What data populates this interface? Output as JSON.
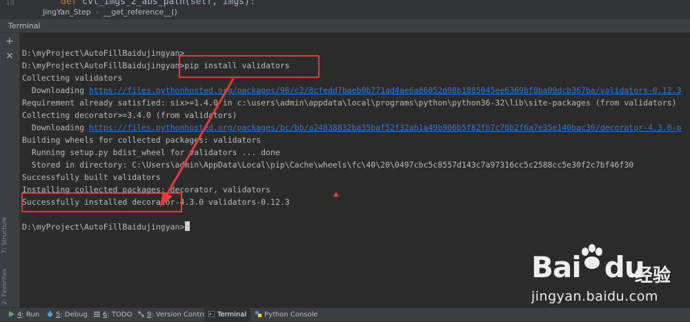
{
  "editor": {
    "line_number": "18",
    "code_keyword": "def",
    "code_rest": " cvt_imgs_2_abs_path(self, imgs):",
    "breadcrumbs": [
      "JingYan_Step",
      "__get_reference__()"
    ]
  },
  "panel": {
    "title": "Terminal",
    "add_label": "+",
    "close_label": "×"
  },
  "side_labels": {
    "structure": "7: Structure",
    "favorites": "2: Favorites"
  },
  "terminal": {
    "lines": [
      {
        "text": "D:\\myProject\\AutoFillBaidujingyan>"
      },
      {
        "text": "D:\\myProject\\AutoFillBaidujingyan>pip install validators"
      },
      {
        "text": "Collecting validators"
      },
      {
        "prefix": "  Downloading ",
        "link": "https://files.pythonhosted.org/packages/98/c2/8cfedd7baeb0b771ad4ae6a86052d08b1885045ee6369bf8ba09dcb367ba/validators-0.12.3"
      },
      {
        "text": "Requirement already satisfied: six>=1.4.0 in c:\\users\\admin\\appdata\\local\\programs\\python\\python36-32\\lib\\site-packages (from validators)"
      },
      {
        "text": "Collecting decorator>=3.4.0 (from validators)"
      },
      {
        "prefix": "  Downloading ",
        "link": "https://files.pythonhosted.org/packages/bc/bb/a24838832ba35baf52f32ab1a49b906b5f82fb7c76b2f6a7e35e140bac30/decorator-4.3.0-p"
      },
      {
        "text": "Building wheels for collected packages: validators"
      },
      {
        "text": "  Running setup.py bdist_wheel for validators ... done"
      },
      {
        "text": "  Stored in directory: C:\\Users\\admin\\AppData\\Local\\pip\\Cache\\wheels\\fc\\40\\20\\0497cbc5c8557d143c7a97316cc5c2588cc5e30f2c7bf46f30"
      },
      {
        "text": "Successfully built validators"
      },
      {
        "text": "Installing collected packages: decorator, validators"
      },
      {
        "text": "Successfully installed decorator-4.3.0 validators-0.12.3"
      },
      {
        "text": ""
      },
      {
        "text": "D:\\myProject\\AutoFillBaidujingyan>"
      }
    ]
  },
  "toolwindows": [
    {
      "num": "4",
      "label": ": Run",
      "icon": "run-icon"
    },
    {
      "num": "5",
      "label": ": Debug",
      "icon": "debug-icon"
    },
    {
      "num": "6",
      "label": ": TODO",
      "icon": "todo-icon"
    },
    {
      "num": "9",
      "label": ": Version Control",
      "icon": "version-control-icon"
    },
    {
      "num": "",
      "label": "Terminal",
      "icon": "terminal-icon",
      "active": true
    },
    {
      "num": "",
      "label": "Python Console",
      "icon": "python-console-icon"
    }
  ],
  "watermark": {
    "brand": "Bai",
    "brand2": "du",
    "cn": "经验",
    "url": "jingyan.baidu.com"
  },
  "colors": {
    "annotation": "#e83a3a",
    "link": "#287bde",
    "terminal_bg": "#2b2b2b"
  }
}
